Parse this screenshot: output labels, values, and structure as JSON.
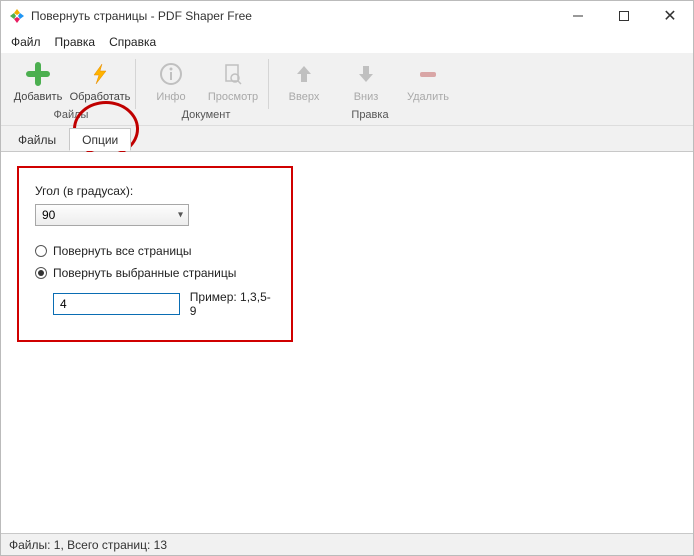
{
  "window": {
    "title": "Повернуть страницы - PDF Shaper Free"
  },
  "menu": {
    "file": "Файл",
    "edit": "Правка",
    "help": "Справка"
  },
  "toolbar": {
    "add": "Добавить",
    "process": "Обработать",
    "info": "Инфо",
    "preview": "Просмотр",
    "up": "Вверх",
    "down": "Вниз",
    "delete": "Удалить",
    "section_files": "Файлы",
    "section_document": "Документ",
    "section_edit": "Правка"
  },
  "tabs": {
    "files": "Файлы",
    "options": "Опции"
  },
  "options": {
    "angle_label": "Угол (в градусах):",
    "angle_value": "90",
    "radio_all": "Повернуть все страницы",
    "radio_selected": "Повернуть выбранные страницы",
    "pages_value": "4",
    "example_label": "Пример: 1,3,5-9"
  },
  "status": {
    "text": "Файлы: 1, Всего страниц: 13"
  }
}
